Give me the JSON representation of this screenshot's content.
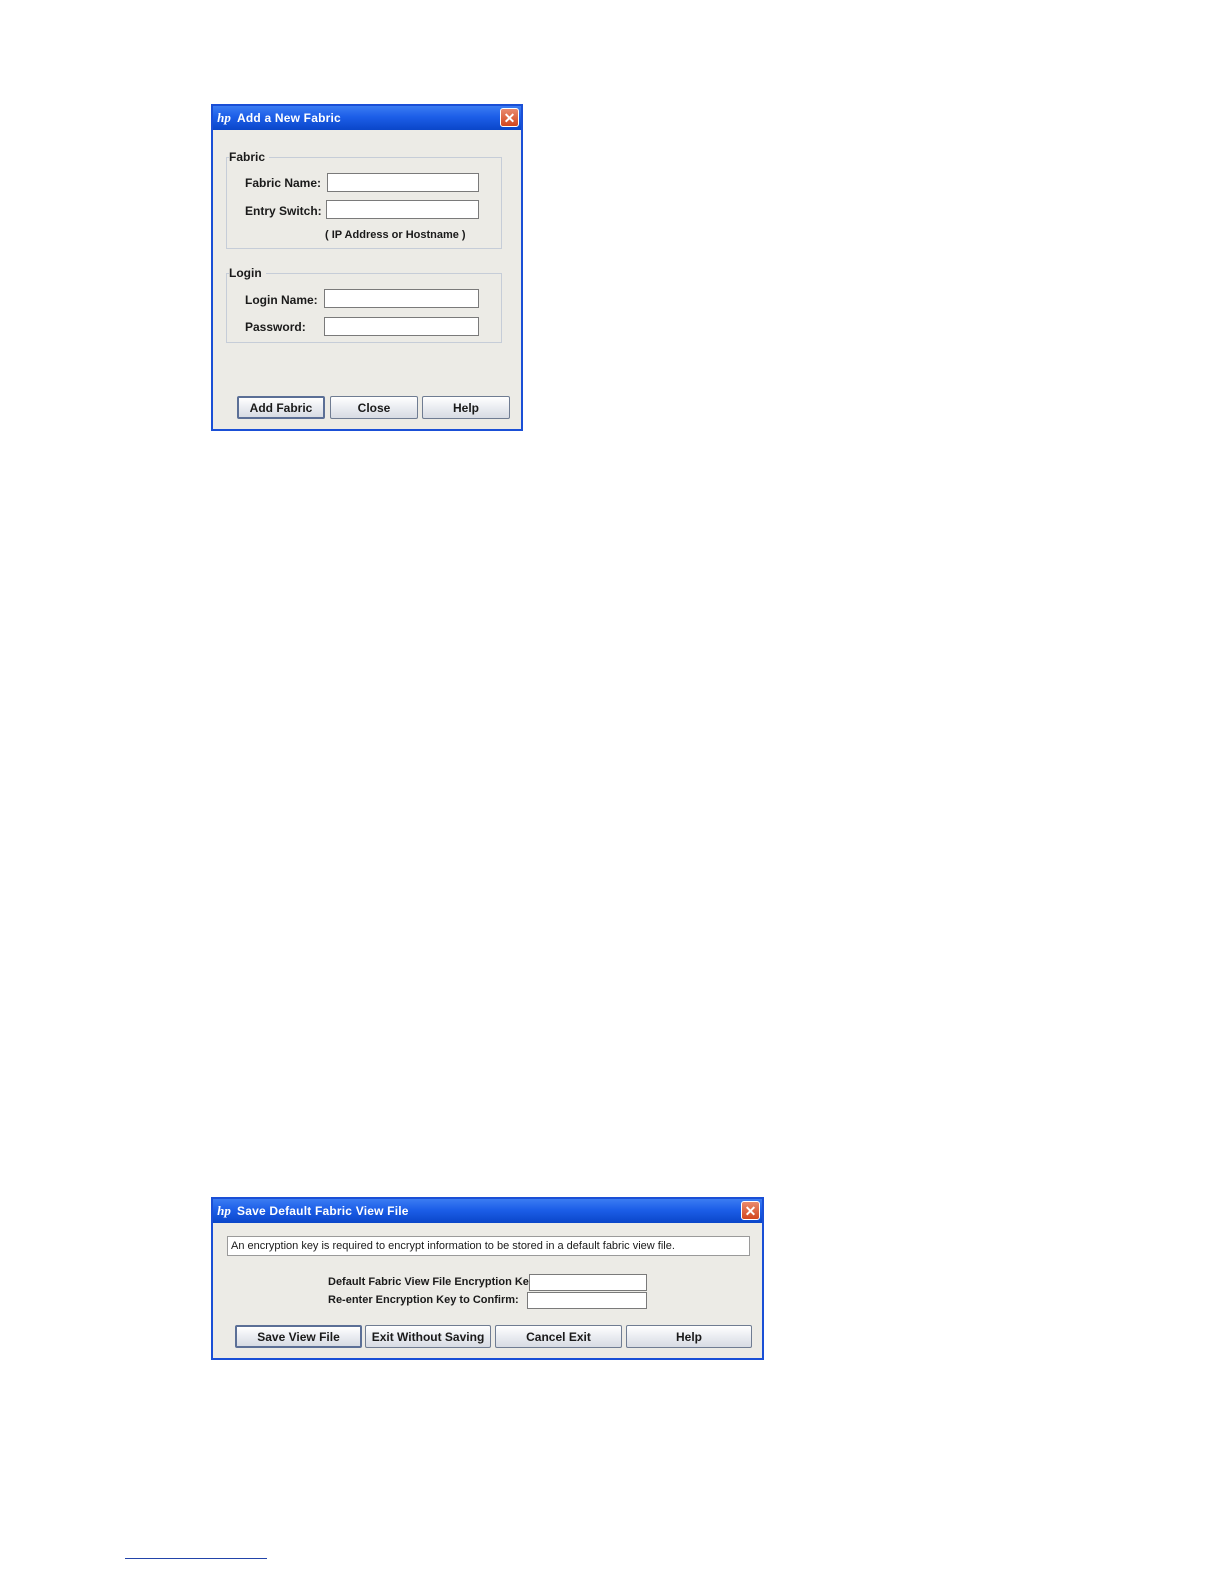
{
  "add_fabric_dialog": {
    "title": "Add a New Fabric",
    "fabric_group": {
      "legend": "Fabric",
      "fabric_name_label": "Fabric Name:",
      "fabric_name_value": "",
      "entry_switch_label": "Entry Switch:",
      "entry_switch_value": "",
      "entry_switch_hint": "( IP Address or Hostname )"
    },
    "login_group": {
      "legend": "Login",
      "login_name_label": "Login Name:",
      "login_name_value": "",
      "password_label": "Password:",
      "password_value": ""
    },
    "buttons": {
      "add_fabric": "Add Fabric",
      "close": "Close",
      "help": "Help"
    }
  },
  "save_view_dialog": {
    "title": "Save Default Fabric View File",
    "message": "An encryption key is required to encrypt information to be stored in a default fabric view file.",
    "encryption_key_label": "Default Fabric View File Encryption Key:",
    "encryption_key_value": "",
    "confirm_key_label": "Re-enter Encryption Key to Confirm:",
    "confirm_key_value": "",
    "buttons": {
      "save_view_file": "Save View File",
      "exit_without_saving": "Exit Without Saving",
      "cancel_exit": "Cancel Exit",
      "help": "Help"
    }
  },
  "colors": {
    "titlebar": "#1c5ee8",
    "window_bg": "#ecebe6",
    "close_button": "#d3461d"
  }
}
